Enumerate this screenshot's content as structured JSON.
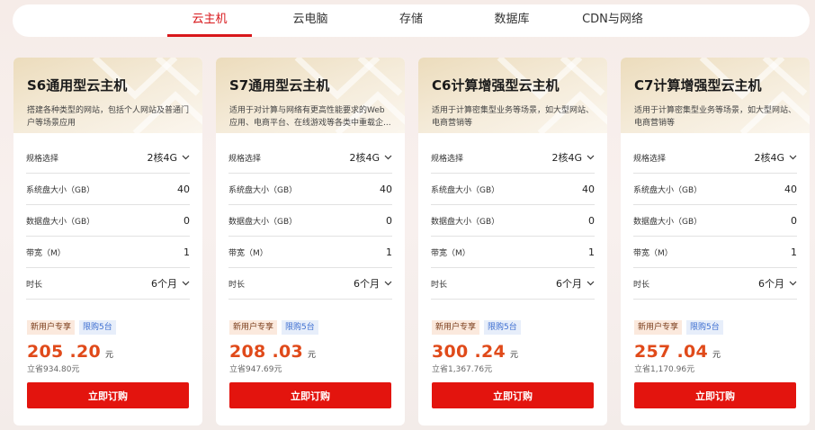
{
  "tabs": [
    {
      "label": "云主机",
      "active": true
    },
    {
      "label": "云电脑",
      "active": false
    },
    {
      "label": "存储",
      "active": false
    },
    {
      "label": "数据库",
      "active": false
    },
    {
      "label": "CDN与网络",
      "active": false
    }
  ],
  "colors": {
    "accent": "#d8171b",
    "price": "#e04a1a",
    "buy_button": "#e3140e"
  },
  "cards": [
    {
      "title": "S6通用型云主机",
      "desc": "搭建各种类型的网站，包括个人网站及普通门户等场景应用",
      "spec_label": "规格选择",
      "spec_value": "2核4G",
      "sysdisk_label": "系统盘大小（GB）",
      "sysdisk_value": "40",
      "datadisk_label": "数据盘大小（GB）",
      "datadisk_value": "0",
      "bandwidth_label": "带宽（M）",
      "bandwidth_value": "1",
      "duration_label": "时长",
      "duration_value": "6个月",
      "badge_new": "新用户专享",
      "badge_limit": "限购5台",
      "price": "205 .20",
      "unit": "元",
      "save": "立省934.80元",
      "buy_label": "立即订购"
    },
    {
      "title": "S7通用型云主机",
      "desc": "适用于对计算与网络有更高性能要求的Web应用、电商平台、在线游戏等各类中重载企...",
      "spec_label": "规格选择",
      "spec_value": "2核4G",
      "sysdisk_label": "系统盘大小（GB）",
      "sysdisk_value": "40",
      "datadisk_label": "数据盘大小（GB）",
      "datadisk_value": "0",
      "bandwidth_label": "带宽（M）",
      "bandwidth_value": "1",
      "duration_label": "时长",
      "duration_value": "6个月",
      "badge_new": "新用户专享",
      "badge_limit": "限购5台",
      "price": "208 .03",
      "unit": "元",
      "save": "立省947.69元",
      "buy_label": "立即订购"
    },
    {
      "title": "C6计算增强型云主机",
      "desc": "适用于计算密集型业务等场景，如大型网站、电商营销等",
      "spec_label": "规格选择",
      "spec_value": "2核4G",
      "sysdisk_label": "系统盘大小（GB）",
      "sysdisk_value": "40",
      "datadisk_label": "数据盘大小（GB）",
      "datadisk_value": "0",
      "bandwidth_label": "带宽（M）",
      "bandwidth_value": "1",
      "duration_label": "时长",
      "duration_value": "6个月",
      "badge_new": "新用户专享",
      "badge_limit": "限购5台",
      "price": "300 .24",
      "unit": "元",
      "save": "立省1,367.76元",
      "buy_label": "立即订购"
    },
    {
      "title": "C7计算增强型云主机",
      "desc": "适用于计算密集型业务等场景，如大型网站、电商营销等",
      "spec_label": "规格选择",
      "spec_value": "2核4G",
      "sysdisk_label": "系统盘大小（GB）",
      "sysdisk_value": "40",
      "datadisk_label": "数据盘大小（GB）",
      "datadisk_value": "0",
      "bandwidth_label": "带宽（M）",
      "bandwidth_value": "1",
      "duration_label": "时长",
      "duration_value": "6个月",
      "badge_new": "新用户专享",
      "badge_limit": "限购5台",
      "price": "257 .04",
      "unit": "元",
      "save": "立省1,170.96元",
      "buy_label": "立即订购"
    }
  ]
}
